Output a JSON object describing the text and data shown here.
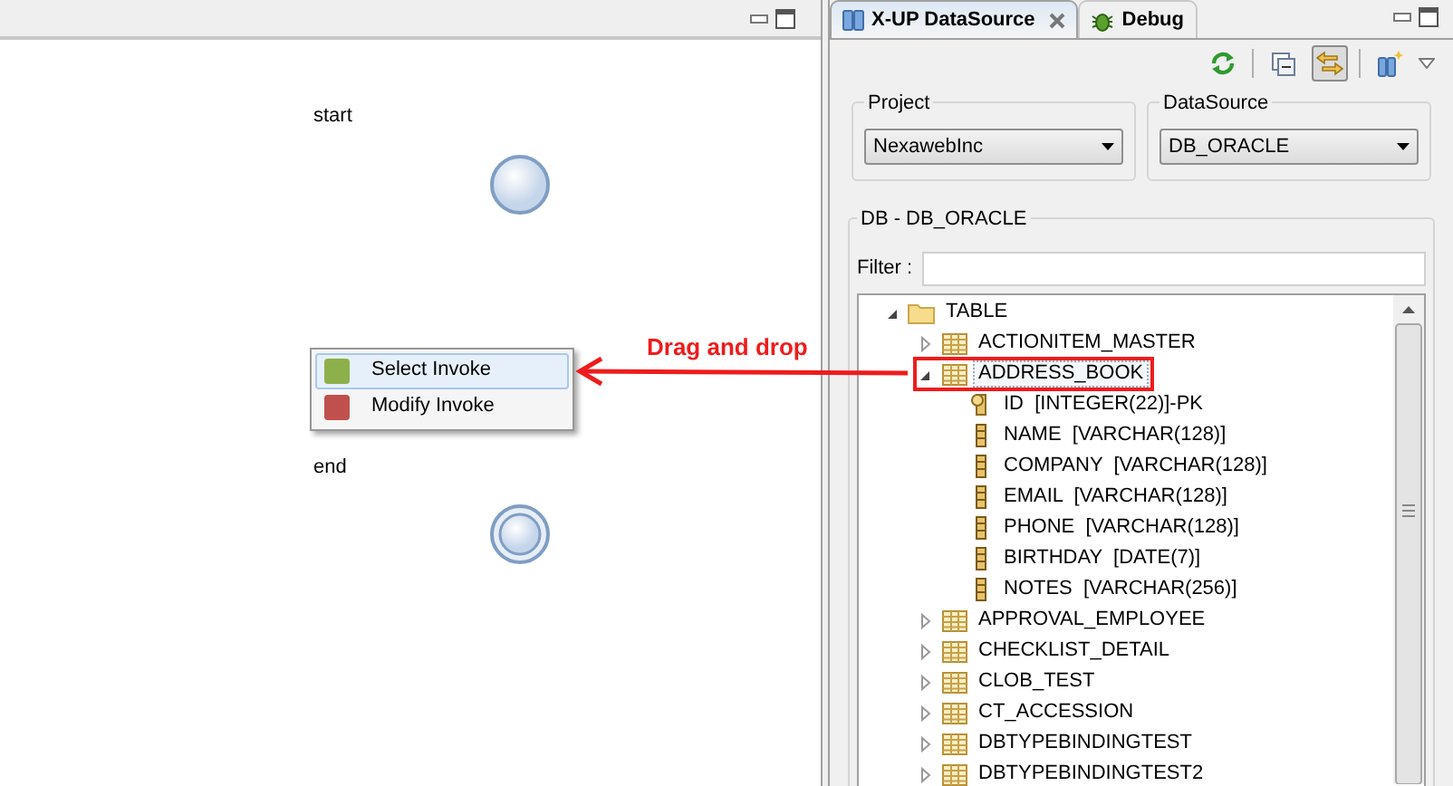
{
  "canvas": {
    "nodes": [
      {
        "kind": "start",
        "label": "start"
      },
      {
        "kind": "end",
        "label": "end"
      }
    ],
    "context_menu": {
      "items": [
        {
          "label": "Select Invoke",
          "color": "#8db04a",
          "selected": true
        },
        {
          "label": "Modify Invoke",
          "color": "#c0504d",
          "selected": false
        }
      ]
    }
  },
  "annotation": {
    "label": "Drag and drop"
  },
  "panel": {
    "tabs": [
      {
        "label": "X-UP DataSource",
        "selected": true,
        "closable": true
      },
      {
        "label": "Debug",
        "selected": false,
        "closable": false
      }
    ],
    "toolbar": [
      {
        "kind": "refresh",
        "pressed": false
      },
      {
        "kind": "collapse",
        "pressed": false
      },
      {
        "kind": "link",
        "pressed": true
      },
      {
        "kind": "new",
        "pressed": false
      }
    ],
    "project": {
      "label": "Project",
      "value": "NexawebInc"
    },
    "datasource": {
      "label": "DataSource",
      "value": "DB_ORACLE"
    },
    "db_group": {
      "title": "DB - DB_ORACLE",
      "filter_label": "Filter :"
    },
    "tree": [
      {
        "kind": "folder",
        "label": "TABLE",
        "expanded": true,
        "children": [
          {
            "kind": "table",
            "label": "ACTIONITEM_MASTER",
            "expanded": false,
            "selected": false,
            "highlighted": false
          },
          {
            "kind": "table",
            "label": "ADDRESS_BOOK",
            "expanded": true,
            "selected": true,
            "highlighted": true,
            "children": [
              {
                "kind": "key",
                "label": "ID  [INTEGER(22)]-PK"
              },
              {
                "kind": "column",
                "label": "NAME  [VARCHAR(128)]"
              },
              {
                "kind": "column",
                "label": "COMPANY  [VARCHAR(128)]"
              },
              {
                "kind": "column",
                "label": "EMAIL  [VARCHAR(128)]"
              },
              {
                "kind": "column",
                "label": "PHONE  [VARCHAR(128)]"
              },
              {
                "kind": "column",
                "label": "BIRTHDAY  [DATE(7)]"
              },
              {
                "kind": "column",
                "label": "NOTES  [VARCHAR(256)]"
              }
            ]
          },
          {
            "kind": "table",
            "label": "APPROVAL_EMPLOYEE",
            "expanded": false,
            "selected": false
          },
          {
            "kind": "table",
            "label": "CHECKLIST_DETAIL",
            "expanded": false,
            "selected": false
          },
          {
            "kind": "table",
            "label": "CLOB_TEST",
            "expanded": false,
            "selected": false
          },
          {
            "kind": "table",
            "label": "CT_ACCESSION",
            "expanded": false,
            "selected": false
          },
          {
            "kind": "table",
            "label": "DBTYPEBINDINGTEST",
            "expanded": false,
            "selected": false
          },
          {
            "kind": "table",
            "label": "DBTYPEBINDINGTEST2",
            "expanded": false,
            "selected": false
          }
        ]
      }
    ]
  }
}
